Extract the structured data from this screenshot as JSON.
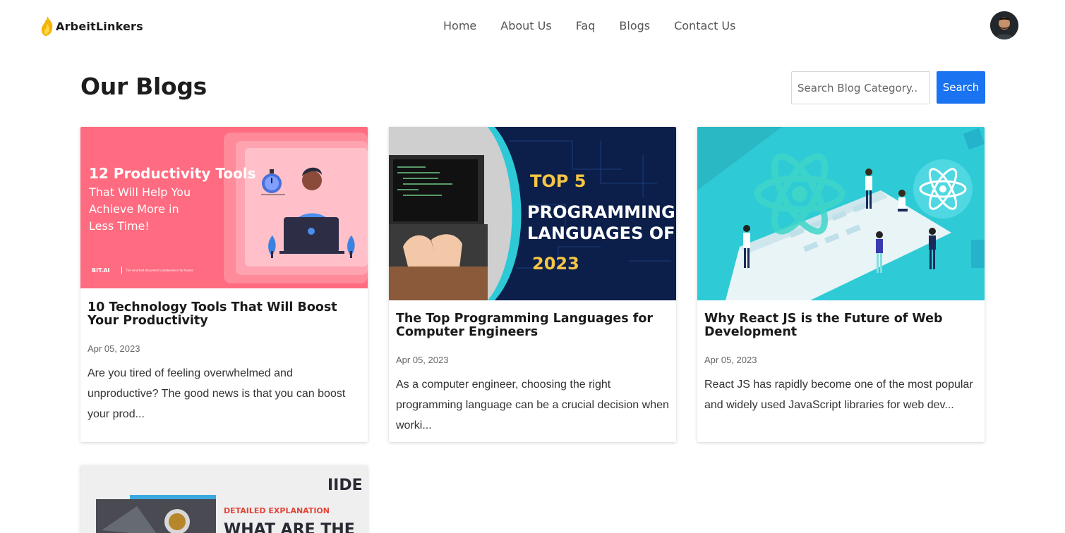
{
  "brand": {
    "name": "ArbeitLinkers"
  },
  "nav": {
    "links": [
      {
        "label": "Home"
      },
      {
        "label": "About Us"
      },
      {
        "label": "Faq"
      },
      {
        "label": "Blogs"
      },
      {
        "label": "Contact Us"
      }
    ]
  },
  "page": {
    "title": "Our Blogs"
  },
  "search": {
    "placeholder": "Search Blog Category..",
    "button_label": "Search"
  },
  "colors": {
    "accent": "#1a73f0",
    "logo_flame": "#f5b40a"
  },
  "blogs": [
    {
      "title": "10 Technology Tools That Will Boost Your Productivity",
      "date": "Apr 05, 2023",
      "excerpt": "Are you tired of feeling overwhelmed and unproductive? The good news is that you can boost your prod...",
      "image": {
        "line1": "12 Productivity Tools",
        "line2": "That Will Help You",
        "line3": "Achieve More in",
        "line4": "Less Time!",
        "brand": "BIT.AI",
        "tagline": "The smartest document collaboration for teams"
      }
    },
    {
      "title": "The Top Programming Languages for Computer Engineers",
      "date": "Apr 05, 2023",
      "excerpt": "As a computer engineer, choosing the right programming language can be a crucial decision when worki...",
      "image": {
        "line1": "TOP 5",
        "line2": "PROGRAMMING",
        "line3": "LANGUAGES OF",
        "line4": "2023"
      }
    },
    {
      "title": "Why React JS is the Future of Web Development",
      "date": "Apr 05, 2023",
      "excerpt": "React JS has rapidly become one of the most popular and widely used JavaScript libraries for web dev..."
    },
    {
      "image": {
        "logo": "IIDE",
        "kicker": "DETAILED EXPLANATION",
        "headline": "WHAT ARE THE"
      }
    }
  ]
}
